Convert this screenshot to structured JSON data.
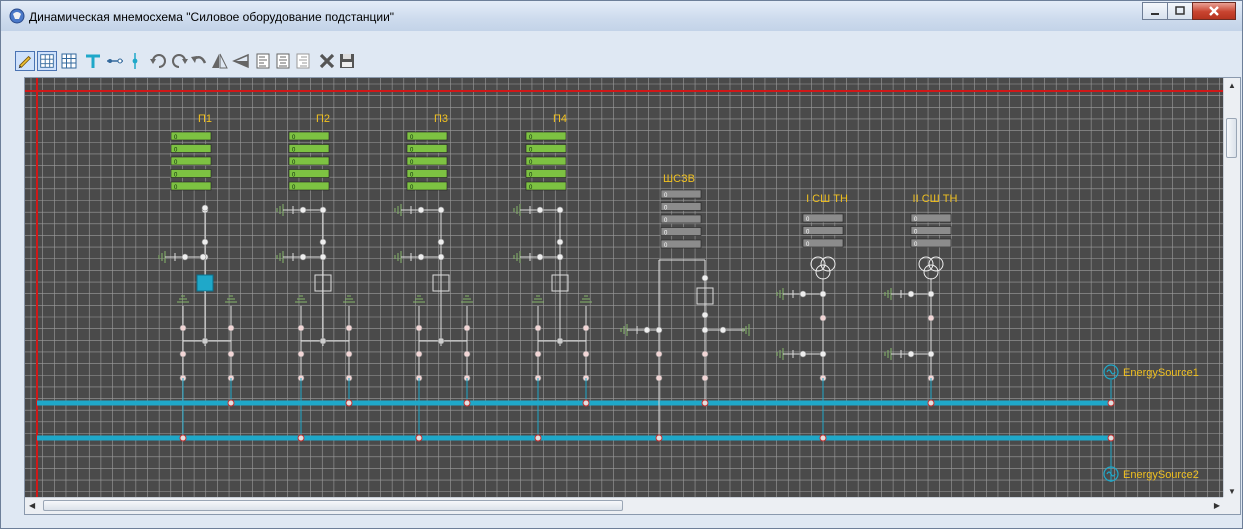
{
  "window": {
    "title": "Динамическая мнемосхема \"Силовое оборудование подстанции\"",
    "buttons": {
      "minimize": "minimize-icon",
      "maximize": "maximize-icon",
      "close": "close-icon"
    }
  },
  "toolbar": {
    "tools": [
      {
        "name": "edit-mode-icon",
        "active": true
      },
      {
        "name": "grid-snap-icon",
        "active": true
      },
      {
        "name": "grid-icon",
        "active": false
      },
      {
        "name": "t-junction-icon",
        "active": false
      },
      {
        "name": "horizontal-connector-icon",
        "active": false
      },
      {
        "name": "vertical-connector-icon",
        "active": false
      },
      {
        "name": "rotate-left-icon",
        "active": false
      },
      {
        "name": "rotate-right-icon",
        "active": false
      },
      {
        "name": "undo-icon",
        "active": false
      },
      {
        "name": "flip-horizontal-icon",
        "active": false
      },
      {
        "name": "flip-vertical-icon",
        "active": false
      },
      {
        "name": "align-left-icon",
        "active": false
      },
      {
        "name": "align-center-icon",
        "active": false
      },
      {
        "name": "align-right-icon",
        "active": false
      },
      {
        "name": "delete-icon",
        "active": false
      },
      {
        "name": "save-icon",
        "active": false
      }
    ]
  },
  "scheme": {
    "colors": {
      "background": "#4a4a4a",
      "grid": "#b9b9b9",
      "bus": "#1fa8c9",
      "label": "#f0c020",
      "indicator_on": "#7dc242",
      "indicator_off": "#8c8c8c",
      "border": "#d01818"
    },
    "feeders": [
      {
        "label": "П1",
        "indicator_value": "0",
        "indicators": 5,
        "on": true
      },
      {
        "label": "П2",
        "indicator_value": "0",
        "indicators": 5,
        "on": true
      },
      {
        "label": "П3",
        "indicator_value": "0",
        "indicators": 5,
        "on": true
      },
      {
        "label": "П4",
        "indicator_value": "0",
        "indicators": 5,
        "on": true
      },
      {
        "label": "ШСЗВ",
        "indicator_value": "0",
        "indicators": 5,
        "on": false
      },
      {
        "label": "I СШ ТН",
        "indicator_value": "0",
        "indicators": 3,
        "on": false
      },
      {
        "label": "II СШ ТН",
        "indicator_value": "0",
        "indicators": 3,
        "on": false
      }
    ],
    "sources": [
      {
        "label": "EnergySource1"
      },
      {
        "label": "EnergySource2"
      }
    ]
  }
}
